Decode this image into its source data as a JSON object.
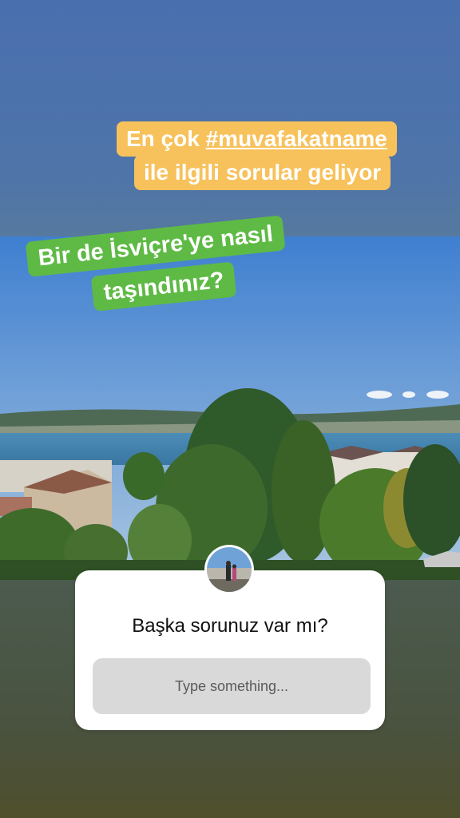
{
  "stickers": {
    "yellow_line1_prefix": "En çok ",
    "yellow_line1_hashtag": "#muvafakatname",
    "yellow_line2": "ile ilgili sorular geliyor",
    "green_line1": "Bir de İsviçre'ye nasıl",
    "green_line2": "taşındınız?"
  },
  "question_sticker": {
    "question": "Başka sorunuz var mı?",
    "input_placeholder": "Type something..."
  },
  "colors": {
    "yellow_sticker": "#f7c15b",
    "green_sticker": "#5eba45",
    "top_background": "#4a6fae",
    "bottom_background": "#4b5443"
  }
}
